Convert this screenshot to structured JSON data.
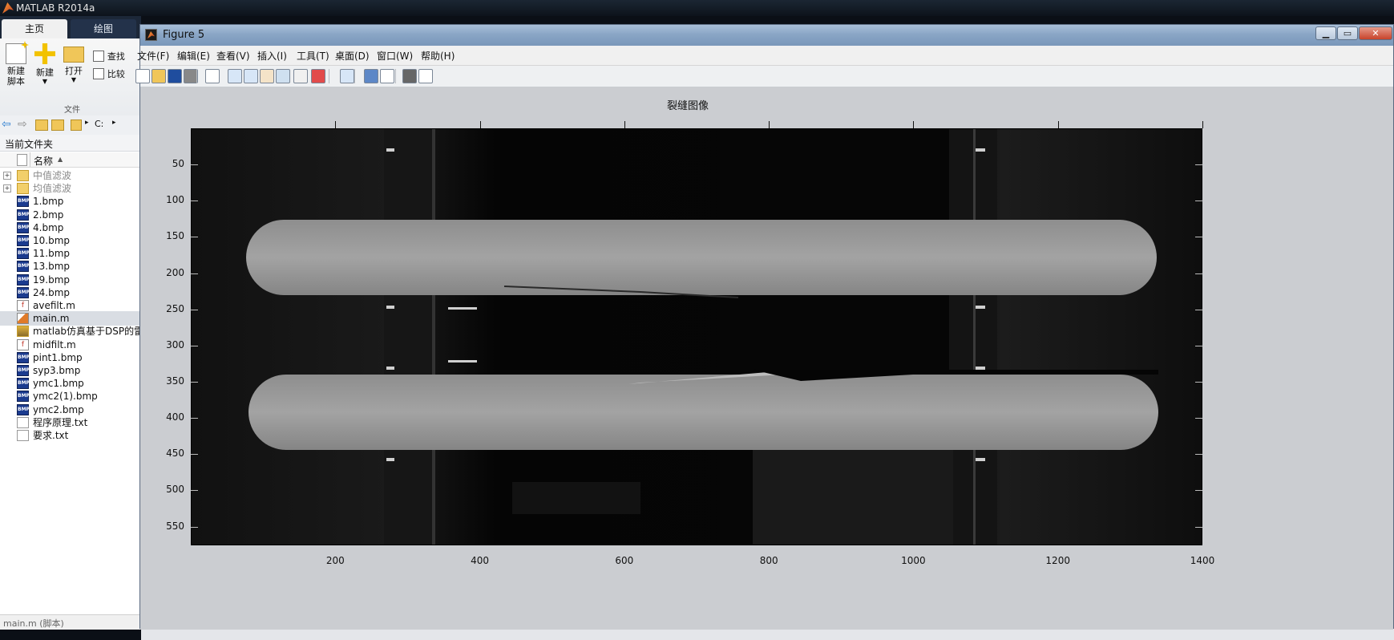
{
  "matlab": {
    "title": "MATLAB R2014a",
    "tabs": [
      "主页",
      "绘图"
    ],
    "ribbon": {
      "new_script": "新建\n脚本",
      "new": "新建",
      "open": "打开",
      "find": "查找",
      "compare": "比较",
      "group_label": "文件"
    },
    "address": "C:",
    "folder_header": "当前文件夹",
    "name_column": "名称",
    "files": [
      {
        "name": "中值滤波",
        "type": "folder"
      },
      {
        "name": "均值滤波",
        "type": "folder"
      },
      {
        "name": "1.bmp",
        "type": "bmp"
      },
      {
        "name": "2.bmp",
        "type": "bmp"
      },
      {
        "name": "4.bmp",
        "type": "bmp"
      },
      {
        "name": "10.bmp",
        "type": "bmp"
      },
      {
        "name": "11.bmp",
        "type": "bmp"
      },
      {
        "name": "13.bmp",
        "type": "bmp"
      },
      {
        "name": "19.bmp",
        "type": "bmp"
      },
      {
        "name": "24.bmp",
        "type": "bmp"
      },
      {
        "name": "avefilt.m",
        "type": "mfunc"
      },
      {
        "name": "main.m",
        "type": "mscript",
        "selected": true
      },
      {
        "name": "matlab仿真基于DSP的雷",
        "type": "mat"
      },
      {
        "name": "midfilt.m",
        "type": "mfunc"
      },
      {
        "name": "pint1.bmp",
        "type": "bmp"
      },
      {
        "name": "syp3.bmp",
        "type": "bmp"
      },
      {
        "name": "ymc1.bmp",
        "type": "bmp"
      },
      {
        "name": "ymc2(1).bmp",
        "type": "bmp"
      },
      {
        "name": "ymc2.bmp",
        "type": "bmp"
      },
      {
        "name": "程序原理.txt",
        "type": "txt"
      },
      {
        "name": "要求.txt",
        "type": "txt"
      }
    ],
    "status": "main.m (脚本)"
  },
  "figure": {
    "title": "Figure 5",
    "menus": [
      "文件(F)",
      "编辑(E)",
      "查看(V)",
      "插入(I)",
      "工具(T)",
      "桌面(D)",
      "窗口(W)",
      "帮助(H)"
    ],
    "toolbar_icons": [
      "new-figure-icon",
      "open-file-icon",
      "save-icon",
      "print-icon",
      "pointer-icon",
      "zoom-in-icon",
      "zoom-out-icon",
      "pan-hand-icon",
      "rotate-icon",
      "data-cursor-icon",
      "brush-icon",
      "link-plot-icon",
      "colorbar-icon",
      "legend-icon",
      "hide-plot-tools-icon",
      "show-plot-tools-icon"
    ],
    "axes_title": "裂缝图像",
    "x_ticks": [
      "200",
      "400",
      "600",
      "800",
      "1000",
      "1200",
      "1400"
    ],
    "y_ticks": [
      "50",
      "100",
      "150",
      "200",
      "250",
      "300",
      "350",
      "400",
      "450",
      "500",
      "550"
    ],
    "image": {
      "description_colors": {
        "background": "#050505",
        "stick": "#9a9a9a"
      },
      "x_range": [
        0,
        1400
      ],
      "y_range": [
        0,
        576
      ],
      "colormap": "gray"
    }
  }
}
